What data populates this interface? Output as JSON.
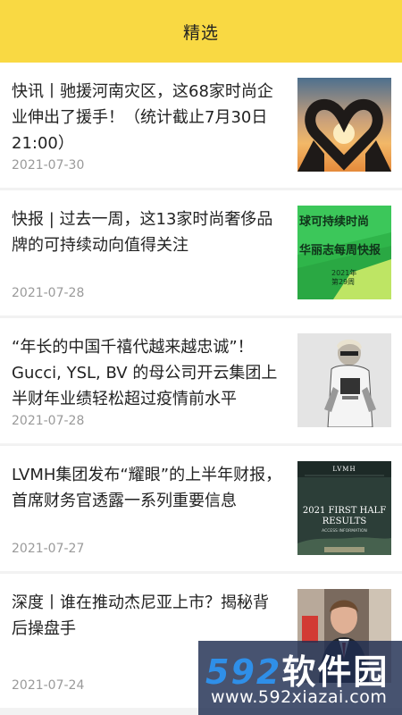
{
  "header": {
    "title": "精选"
  },
  "articles": [
    {
      "title": "快讯丨驰援河南灾区，这68家时尚企业伸出了援手！（统计截止7月30日21:00）",
      "date": "2021-07-30",
      "thumb": "hands-heart-sunset-image"
    },
    {
      "title": "快报 | 过去一周，这13家时尚奢侈品牌的可持续动向值得关注",
      "date": "2021-07-28",
      "thumb": "green-sustainability-banner-image",
      "thumb_text": [
        "球可持续时尚",
        "华丽志每周快报",
        "2021年",
        "第29周"
      ]
    },
    {
      "title": "“年长的中国千禧代越来越忠诚”！Gucci, YSL, BV 的母公司开云集团上半财年业绩轻松超过疫情前水平",
      "date": "2021-07-28",
      "thumb": "fashion-model-photo"
    },
    {
      "title": "LVMH集团发布“耀眼”的上半年财报，首席财务官透露一系列重要信息",
      "date": "2021-07-27",
      "thumb": "lvmh-report-cover-image",
      "thumb_text": [
        "LVMH",
        "2021 FIRST HALF",
        "RESULTS",
        "ACCESS INFORMATION"
      ]
    },
    {
      "title": "深度丨谁在推动杰尼亚上市？揭秘背后操盘手",
      "date": "2021-07-24",
      "thumb": "businessman-portrait-photo"
    }
  ],
  "watermark": {
    "brand_digits": "592",
    "brand_cn": "软件园",
    "url": "www.592xiazai.com"
  }
}
